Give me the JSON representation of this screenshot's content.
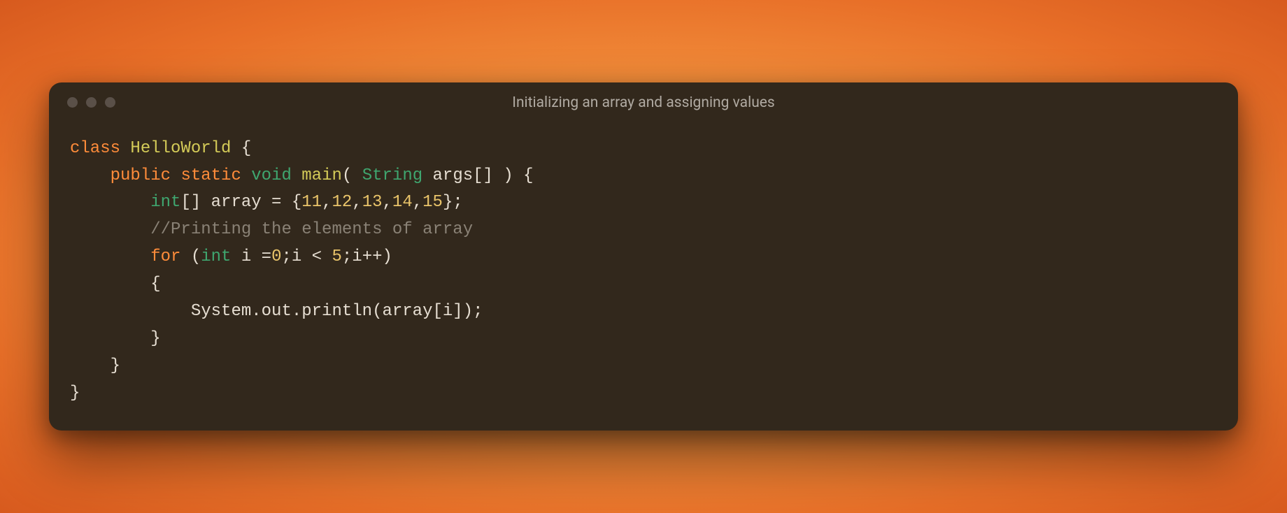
{
  "window": {
    "title": "Initializing an array and assigning values",
    "traffic_lights": [
      "close",
      "minimize",
      "zoom"
    ]
  },
  "code": {
    "language": "java",
    "lines": [
      {
        "indent": 0,
        "tokens": [
          {
            "t": "class ",
            "c": "kw"
          },
          {
            "t": "HelloWorld",
            "c": "cls"
          },
          {
            "t": " {",
            "c": "default"
          }
        ]
      },
      {
        "indent": 1,
        "tokens": [
          {
            "t": "public ",
            "c": "kw"
          },
          {
            "t": "static ",
            "c": "kw"
          },
          {
            "t": "void ",
            "c": "type"
          },
          {
            "t": "main",
            "c": "fn"
          },
          {
            "t": "( ",
            "c": "default"
          },
          {
            "t": "String",
            "c": "type"
          },
          {
            "t": " args[] ) {",
            "c": "default"
          }
        ]
      },
      {
        "indent": 2,
        "tokens": [
          {
            "t": "int",
            "c": "type"
          },
          {
            "t": "[] array = {",
            "c": "default"
          },
          {
            "t": "11",
            "c": "num"
          },
          {
            "t": ",",
            "c": "default"
          },
          {
            "t": "12",
            "c": "num"
          },
          {
            "t": ",",
            "c": "default"
          },
          {
            "t": "13",
            "c": "num"
          },
          {
            "t": ",",
            "c": "default"
          },
          {
            "t": "14",
            "c": "num"
          },
          {
            "t": ",",
            "c": "default"
          },
          {
            "t": "15",
            "c": "num"
          },
          {
            "t": "};",
            "c": "default"
          }
        ]
      },
      {
        "indent": 2,
        "tokens": [
          {
            "t": "//Printing the elements of array",
            "c": "cmt"
          }
        ]
      },
      {
        "indent": 2,
        "tokens": [
          {
            "t": "for ",
            "c": "kw"
          },
          {
            "t": "(",
            "c": "default"
          },
          {
            "t": "int",
            "c": "type"
          },
          {
            "t": " i =",
            "c": "default"
          },
          {
            "t": "0",
            "c": "num"
          },
          {
            "t": ";i < ",
            "c": "default"
          },
          {
            "t": "5",
            "c": "num"
          },
          {
            "t": ";i++)",
            "c": "default"
          }
        ]
      },
      {
        "indent": 2,
        "tokens": [
          {
            "t": "{",
            "c": "default"
          }
        ]
      },
      {
        "indent": 3,
        "tokens": [
          {
            "t": "System.out.println(array[i]);",
            "c": "default"
          }
        ]
      },
      {
        "indent": 2,
        "tokens": [
          {
            "t": "}",
            "c": "default"
          }
        ]
      },
      {
        "indent": 1,
        "tokens": [
          {
            "t": "}",
            "c": "default"
          }
        ]
      },
      {
        "indent": 0,
        "tokens": [
          {
            "t": "}",
            "c": "default"
          }
        ]
      }
    ],
    "indent_unit": "    "
  }
}
